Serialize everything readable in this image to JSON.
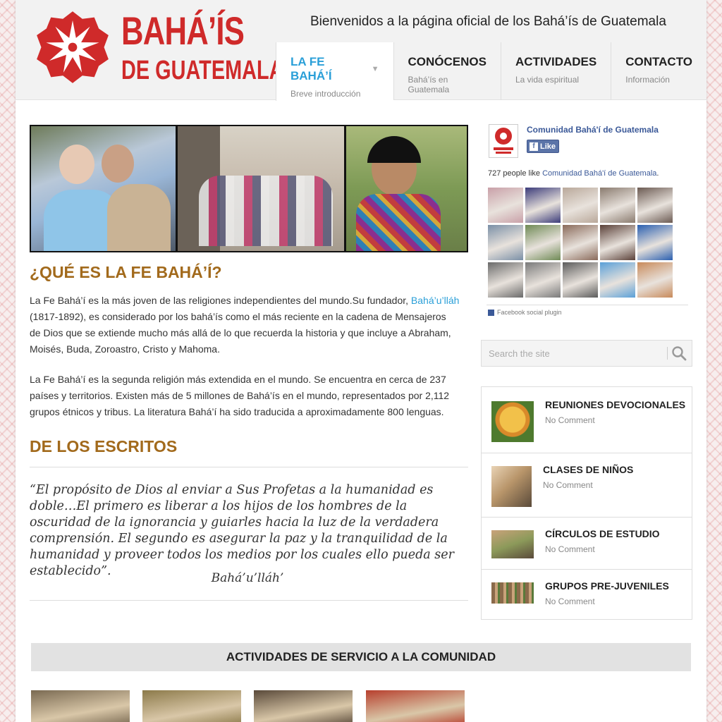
{
  "header": {
    "logo_line1": "BAHÁ’ÍS",
    "logo_line2": "DE GUATEMALA",
    "welcome": "Bienvenidos a la página oficial de los Bahá’ís de Guatemala",
    "brand_color": "#cf2a2a",
    "nav": [
      {
        "title": "LA FE BAHÁ’Í",
        "sub": "Breve introducción",
        "active": true
      },
      {
        "title": "CONÓCENOS",
        "sub": "Bahá’ís en Guatemala"
      },
      {
        "title": "ACTIVIDADES",
        "sub": "La vida espiritual"
      },
      {
        "title": "CONTACTO",
        "sub": "Información"
      }
    ]
  },
  "main": {
    "section1_title": "¿QUÉ ES LA FE BAHÁ’Í?",
    "p1_before": "La Fe Bahá’í es la más joven de las religiones independientes del mundo.Su fundador, ",
    "p1_link": "Bahá’u’lláh",
    "p1_after": " (1817-1892), es considerado por los bahá’ís como el más reciente en la cadena de Mensajeros de Dios que se extiende mucho más allá de lo que recuerda la historia y que incluye a Abraham, Moisés, Buda, Zoroastro, Cristo y Mahoma.",
    "p2": "La Fe Bahá’í es la segunda religión más extendida en el mundo. Se encuentra en cerca de 237 países y territorios. Existen más de 5 millones de Bahá’ís en el mundo, representados por 2,112 grupos étnicos y tribus. La literatura Bahá’í ha sido traducida a aproximadamente 800 lenguas.",
    "section2_title": "DE LOS ESCRITOS",
    "quote": "“El propósito de Dios al enviar a Sus Profetas a la humanidad es doble…El primero es liberar a los hijos de los hombres de la oscuridad de la ignorancia y guiarles hacia la luz de la verdadera comprensión. El segundo es asegurar la paz y la tranquilidad de la humanidad y proveer todos los medios por los cuales ello pueda ser establecido”.",
    "quote_author": "Bahá’u’lláh’",
    "heading_color": "#a26a1c",
    "link_color": "#2a9fd8"
  },
  "facebook": {
    "page_name": "Comunidad Bahá'í de Guatemala",
    "like_label": "Like",
    "like_count_text": "727 people like ",
    "like_count_link": "Comunidad Bahá'í de Guatemala",
    "like_count_end": ".",
    "plugin_label": "Facebook social plugin",
    "face_colors": [
      "#c9a0a8",
      "#3b3b7a",
      "#b9a89a",
      "#8a7b6f",
      "#6b5a52",
      "#7a8fa6",
      "#6f8a55",
      "#8a6a5a",
      "#5a4038",
      "#2a5fb0",
      "#6a6a6a",
      "#7a7a7a",
      "#5b5b5b",
      "#5aa0d8",
      "#c88a5a"
    ]
  },
  "search": {
    "placeholder": "Search the site"
  },
  "posts": [
    {
      "title": "REUNIONES DEVOCIONALES",
      "meta": "No Comment",
      "thumb": "#d9a23a"
    },
    {
      "title": "CLASES DE NIÑOS",
      "meta": "No Comment",
      "thumb": "#b8956a"
    },
    {
      "title": "CÍRCULOS DE ESTUDIO",
      "meta": "No Comment",
      "thumb": "#8c9a5a"
    },
    {
      "title": "GRUPOS PRE-JUVENILES",
      "meta": "No Comment",
      "thumb": "#8a6a4a"
    }
  ],
  "service": {
    "title": "ACTIVIDADES DE SERVICIO A LA COMUNIDAD",
    "thumbs": [
      "#7a6a52",
      "#8c7a4a",
      "#5a4a3a",
      "#b7402e"
    ]
  }
}
